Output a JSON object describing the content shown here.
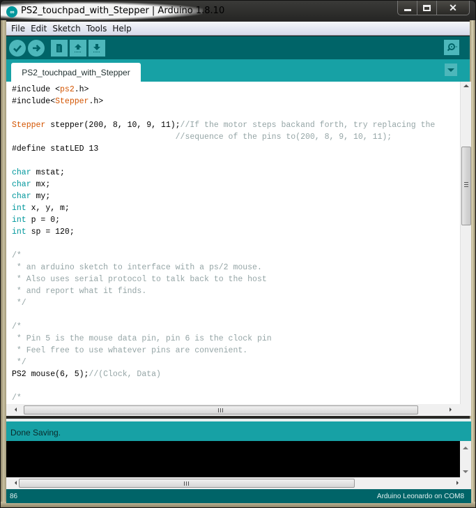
{
  "window": {
    "title": "PS2_touchpad_with_Stepper | Arduino 1.8.10",
    "controls": {
      "minimize": "minimize",
      "maximize": "maximize",
      "close": "close"
    }
  },
  "menubar": {
    "items": [
      "File",
      "Edit",
      "Sketch",
      "Tools",
      "Help"
    ]
  },
  "toolbar": {
    "buttons": [
      {
        "name": "verify",
        "icon": "check-icon"
      },
      {
        "name": "upload",
        "icon": "arrow-right-icon"
      },
      {
        "name": "new",
        "icon": "document-icon"
      },
      {
        "name": "open",
        "icon": "arrow-up-icon"
      },
      {
        "name": "save",
        "icon": "arrow-down-icon"
      }
    ],
    "serial_monitor": {
      "icon": "magnifier-icon"
    }
  },
  "tabs": {
    "items": [
      {
        "label": "PS2_touchpad_with_Stepper",
        "active": true
      }
    ],
    "menu_icon": "triangle-down-icon"
  },
  "editor": {
    "lines": [
      [
        {
          "t": "#include <"
        },
        {
          "t": "ps2",
          "c": "kw-lib"
        },
        {
          "t": ".h>"
        }
      ],
      [
        {
          "t": "#include<"
        },
        {
          "t": "Stepper",
          "c": "kw-lib"
        },
        {
          "t": ".h>"
        }
      ],
      [
        {
          "t": ""
        }
      ],
      [
        {
          "t": "Stepper",
          "c": "kw-lib"
        },
        {
          "t": " stepper(200, 8, 10, 9, 11);"
        },
        {
          "t": "//If the motor steps backand forth, try replacing the",
          "c": "cm"
        }
      ],
      [
        {
          "t": "                                  "
        },
        {
          "t": "//sequence of the pins to(200, 8, 9, 10, 11);",
          "c": "cm"
        }
      ],
      [
        {
          "t": "#define statLED 13"
        }
      ],
      [
        {
          "t": ""
        }
      ],
      [
        {
          "t": "char",
          "c": "kw-type"
        },
        {
          "t": " mstat;"
        }
      ],
      [
        {
          "t": "char",
          "c": "kw-type"
        },
        {
          "t": " mx;"
        }
      ],
      [
        {
          "t": "char",
          "c": "kw-type"
        },
        {
          "t": " my;"
        }
      ],
      [
        {
          "t": "int",
          "c": "kw-type"
        },
        {
          "t": " x, y, m;"
        }
      ],
      [
        {
          "t": "int",
          "c": "kw-type"
        },
        {
          "t": " p = 0;"
        }
      ],
      [
        {
          "t": "int",
          "c": "kw-type"
        },
        {
          "t": " sp = 120;"
        }
      ],
      [
        {
          "t": ""
        }
      ],
      [
        {
          "t": "/*",
          "c": "cm"
        }
      ],
      [
        {
          "t": " * an arduino sketch to interface with a ps/2 mouse.",
          "c": "cm"
        }
      ],
      [
        {
          "t": " * Also uses serial protocol to talk back to the host",
          "c": "cm"
        }
      ],
      [
        {
          "t": " * and report what it finds.",
          "c": "cm"
        }
      ],
      [
        {
          "t": " */",
          "c": "cm"
        }
      ],
      [
        {
          "t": ""
        }
      ],
      [
        {
          "t": "/*",
          "c": "cm"
        }
      ],
      [
        {
          "t": " * Pin 5 is the mouse data pin, pin 6 is the clock pin",
          "c": "cm"
        }
      ],
      [
        {
          "t": " * Feel free to use whatever pins are convenient.",
          "c": "cm"
        }
      ],
      [
        {
          "t": " */",
          "c": "cm"
        }
      ],
      [
        {
          "t": "PS2 mouse(6, 5);"
        },
        {
          "t": "//(Clock, Data)",
          "c": "cm"
        }
      ],
      [
        {
          "t": ""
        }
      ],
      [
        {
          "t": "/*",
          "c": "cm"
        }
      ]
    ]
  },
  "status": {
    "message": "Done Saving."
  },
  "console": {
    "text": ""
  },
  "footer": {
    "line_number": "86",
    "board": "Arduino Leonardo on COM8"
  },
  "colors": {
    "toolbar": "#006468",
    "tabbar": "#17a1a5",
    "button": "#4db7bb",
    "keyword_type": "#00979c",
    "keyword_lib": "#d35400",
    "comment": "#95a5a6"
  }
}
